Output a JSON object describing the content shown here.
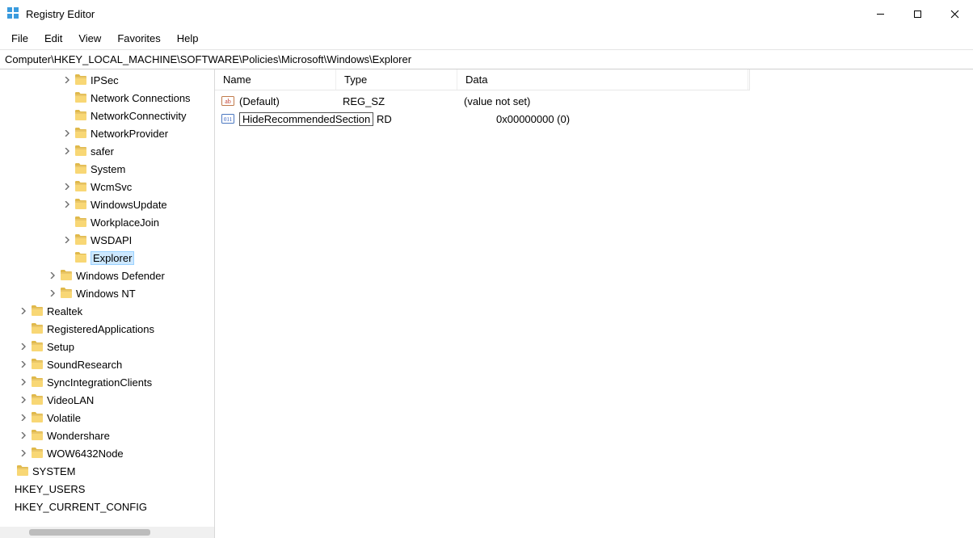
{
  "title": "Registry Editor",
  "menu": {
    "file": "File",
    "edit": "Edit",
    "view": "View",
    "favorites": "Favorites",
    "help": "Help"
  },
  "address": "Computer\\HKEY_LOCAL_MACHINE\\SOFTWARE\\Policies\\Microsoft\\Windows\\Explorer",
  "tree": [
    {
      "indent": 4,
      "exp": ">",
      "label": "IPSec"
    },
    {
      "indent": 4,
      "exp": "",
      "label": "Network Connections"
    },
    {
      "indent": 4,
      "exp": "",
      "label": "NetworkConnectivity"
    },
    {
      "indent": 4,
      "exp": ">",
      "label": "NetworkProvider"
    },
    {
      "indent": 4,
      "exp": ">",
      "label": "safer"
    },
    {
      "indent": 4,
      "exp": "",
      "label": "System"
    },
    {
      "indent": 4,
      "exp": ">",
      "label": "WcmSvc"
    },
    {
      "indent": 4,
      "exp": ">",
      "label": "WindowsUpdate"
    },
    {
      "indent": 4,
      "exp": "",
      "label": "WorkplaceJoin"
    },
    {
      "indent": 4,
      "exp": ">",
      "label": "WSDAPI"
    },
    {
      "indent": 4,
      "exp": "",
      "label": "Explorer",
      "sel": true,
      "open": true
    },
    {
      "indent": 3,
      "exp": ">",
      "label": "Windows Defender"
    },
    {
      "indent": 3,
      "exp": ">",
      "label": "Windows NT"
    },
    {
      "indent": 1,
      "exp": ">",
      "label": "Realtek"
    },
    {
      "indent": 1,
      "exp": "",
      "label": "RegisteredApplications"
    },
    {
      "indent": 1,
      "exp": ">",
      "label": "Setup"
    },
    {
      "indent": 1,
      "exp": ">",
      "label": "SoundResearch"
    },
    {
      "indent": 1,
      "exp": ">",
      "label": "SyncIntegrationClients"
    },
    {
      "indent": 1,
      "exp": ">",
      "label": "VideoLAN"
    },
    {
      "indent": 1,
      "exp": ">",
      "label": "Volatile"
    },
    {
      "indent": 1,
      "exp": ">",
      "label": "Wondershare"
    },
    {
      "indent": 1,
      "exp": ">",
      "label": "WOW6432Node"
    },
    {
      "indent": 0,
      "exp": "",
      "label": "SYSTEM"
    },
    {
      "indent": 0,
      "exp": "",
      "nofolder": true,
      "label": "HKEY_USERS"
    },
    {
      "indent": 0,
      "exp": "",
      "nofolder": true,
      "label": "HKEY_CURRENT_CONFIG"
    }
  ],
  "cols": {
    "name": "Name",
    "type": "Type",
    "data": "Data"
  },
  "values": [
    {
      "icon": "ab",
      "name": "(Default)",
      "type": "REG_SZ",
      "data": "(value not set)"
    },
    {
      "icon": "011",
      "name_edit": "HideRecommendedSection",
      "type_suffix": "RD",
      "data": "0x00000000 (0)"
    }
  ]
}
